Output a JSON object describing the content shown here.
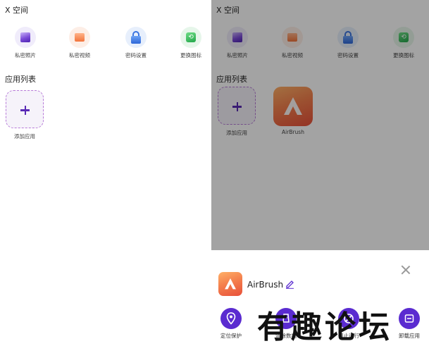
{
  "left": {
    "title": "X 空间",
    "features": [
      {
        "label": "私密照片",
        "icon": "photo-icon"
      },
      {
        "label": "私密视频",
        "icon": "video-icon"
      },
      {
        "label": "密码设置",
        "icon": "lock-icon"
      },
      {
        "label": "更换图标",
        "icon": "swap-icon"
      }
    ],
    "section_title": "应用列表",
    "add_label": "添加应用"
  },
  "right": {
    "title": "X 空间",
    "features": [
      {
        "label": "私密照片",
        "icon": "photo-icon"
      },
      {
        "label": "私密视频",
        "icon": "video-icon"
      },
      {
        "label": "密码设置",
        "icon": "lock-icon"
      },
      {
        "label": "更换图标",
        "icon": "swap-icon"
      }
    ],
    "section_title": "应用列表",
    "add_label": "添加应用",
    "app_label": "AirBrush",
    "sheet": {
      "app_name": "AirBrush",
      "actions": [
        {
          "label": "定位保护",
          "icon": "location-icon"
        },
        {
          "label": "清除数据",
          "icon": "broom-icon"
        },
        {
          "label": "停止运行",
          "icon": "stop-icon"
        },
        {
          "label": "卸载应用",
          "icon": "uninstall-icon"
        }
      ]
    }
  },
  "watermark": "有趣论坛",
  "colors": {
    "accent": "#5a2bd0",
    "overlay": "rgba(0,0,0,0.36)",
    "app_gradient_top": "#ffb067",
    "app_gradient_bottom": "#e8503a"
  }
}
